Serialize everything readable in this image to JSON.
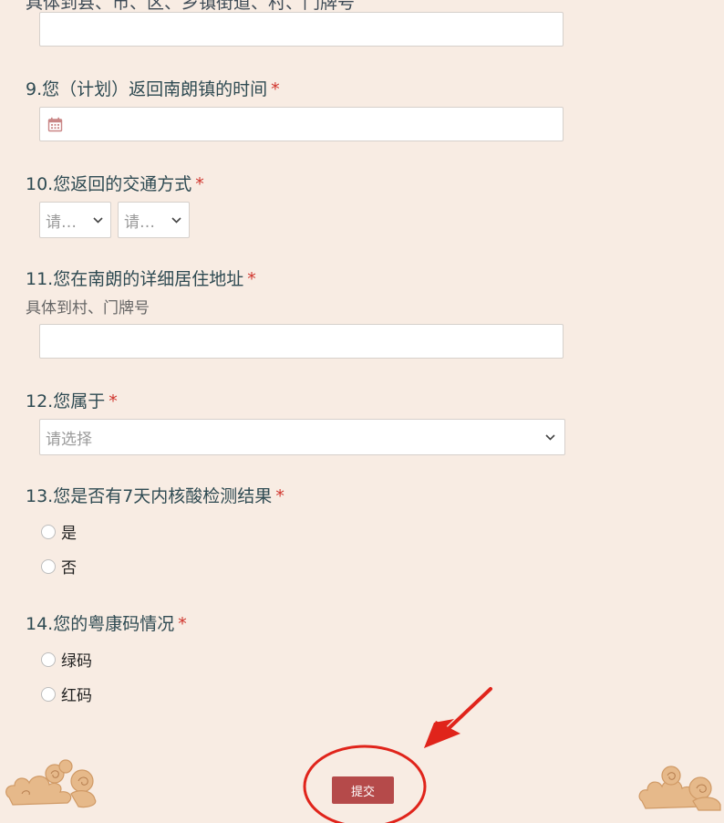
{
  "partial_header_text": "具体到县、市、区、乡镇街道、村、门牌号",
  "questions": [
    {
      "title": "9.您（计划）返回南朗镇的时间",
      "required_mark": "*"
    },
    {
      "title": "10.您返回的交通方式",
      "required_mark": "*",
      "selects": [
        "请…",
        "请…"
      ]
    },
    {
      "title": "11.您在南朗的详细居住地址",
      "required_mark": "*",
      "description": "具体到村、门牌号"
    },
    {
      "title": "12.您属于",
      "required_mark": "*",
      "select_placeholder": "请选择"
    },
    {
      "title": "13.您是否有7天内核酸检测结果",
      "required_mark": "*",
      "options": [
        "是",
        "否"
      ]
    },
    {
      "title": "14.您的粤康码情况",
      "required_mark": "*",
      "options": [
        "绿码",
        "红码"
      ]
    }
  ],
  "submit": {
    "label": "提交"
  },
  "icons": {
    "date": "calendar-icon",
    "dropdown": "chevron-down-icon"
  },
  "colors": {
    "background": "#f8ece3",
    "required": "#d0342c",
    "submit_bg": "#b54a4a",
    "annotation": "#e0241b"
  }
}
